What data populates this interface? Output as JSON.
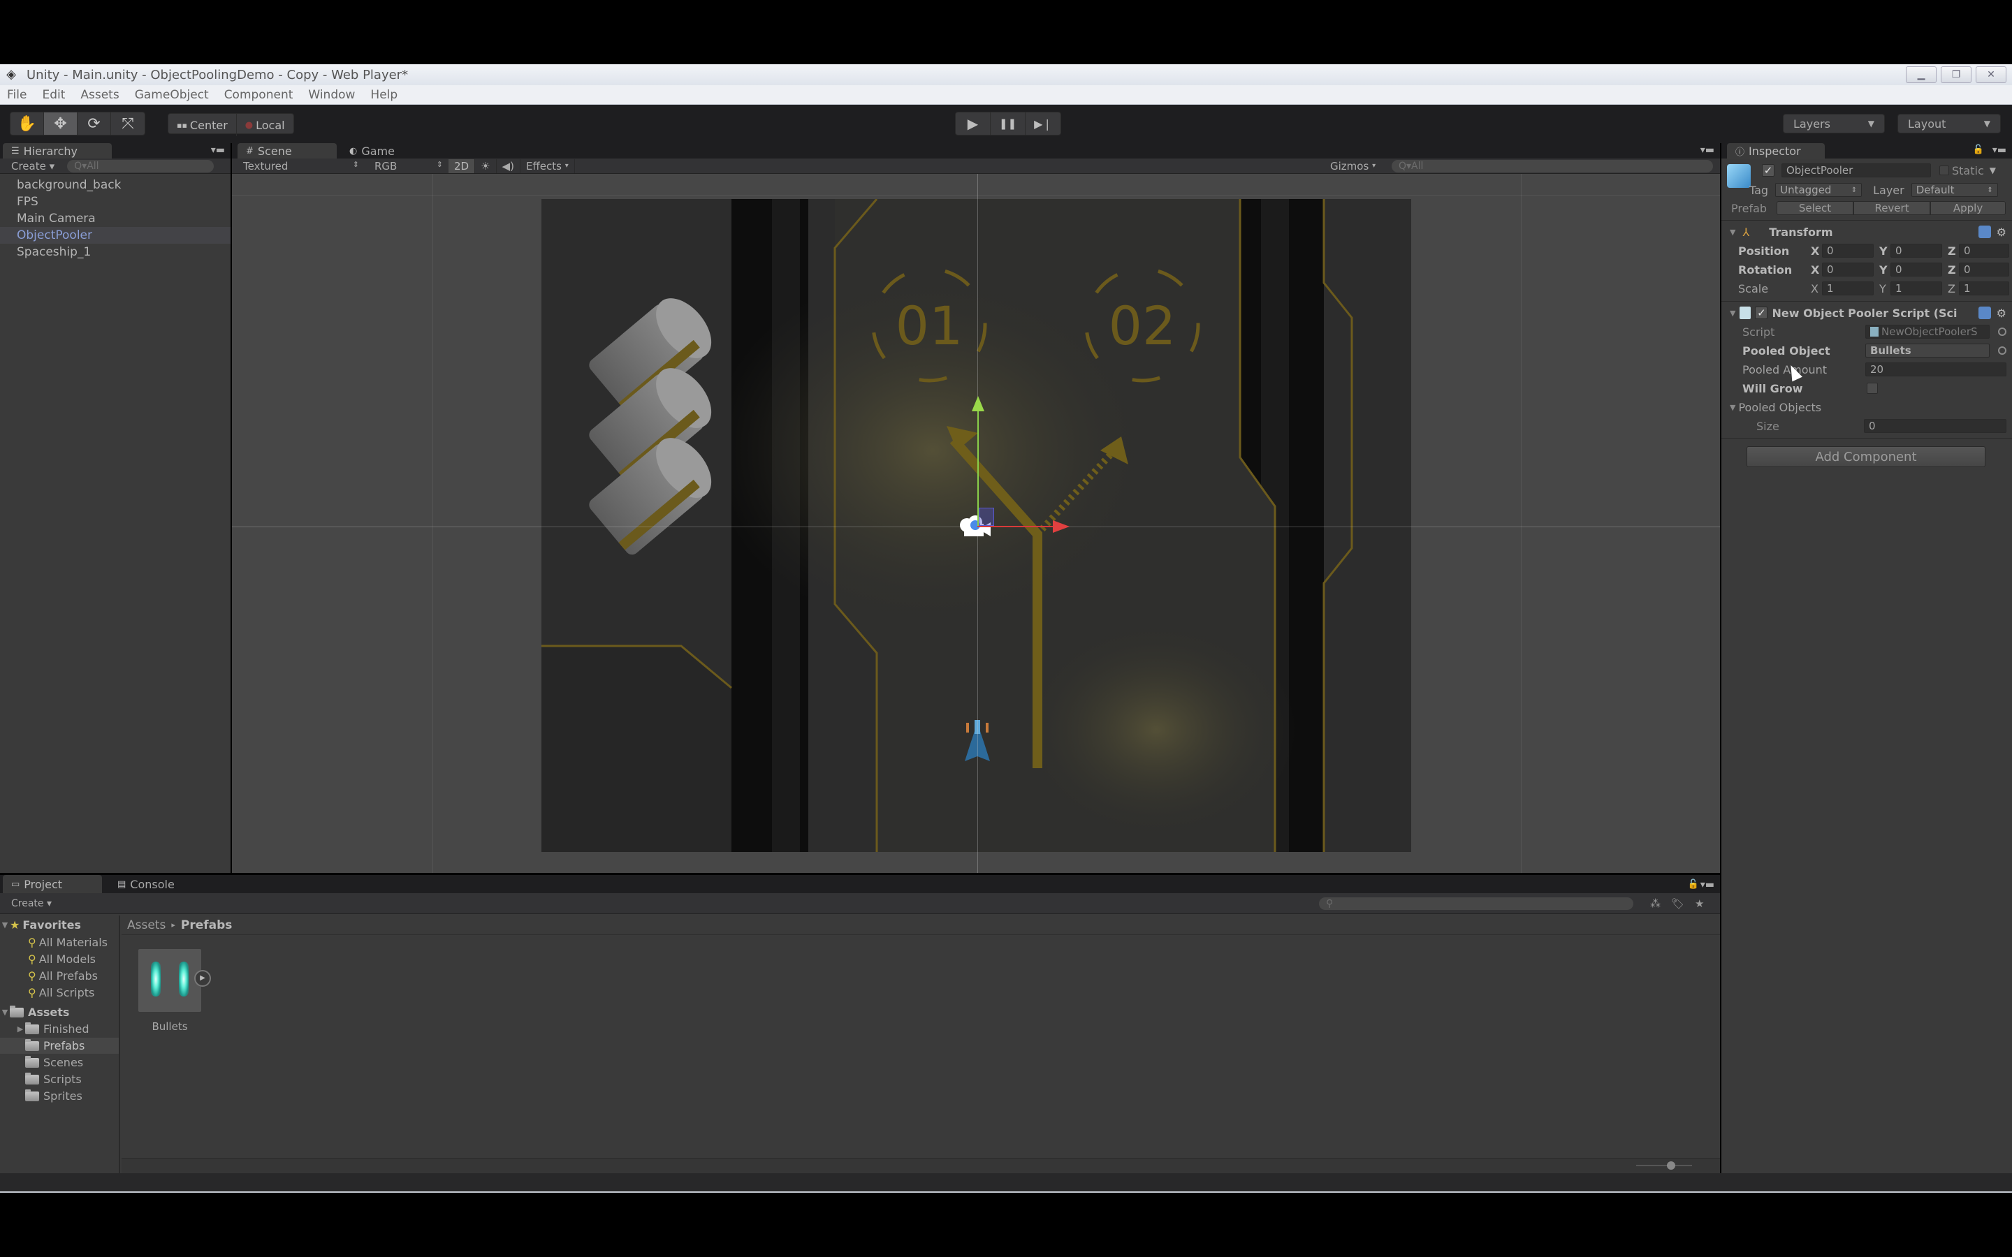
{
  "window": {
    "title": "Unity - Main.unity - ObjectPoolingDemo - Copy - Web Player*",
    "controls": [
      "minimize-icon",
      "restore-icon",
      "close-icon"
    ]
  },
  "menubar": {
    "items": [
      "File",
      "Edit",
      "Assets",
      "GameObject",
      "Component",
      "Window",
      "Help"
    ]
  },
  "toolbar": {
    "transform_tools": [
      {
        "name": "hand",
        "icon": "✋"
      },
      {
        "name": "move",
        "icon": "✥"
      },
      {
        "name": "rotate",
        "icon": "⟳"
      },
      {
        "name": "scale",
        "icon": "⤧"
      }
    ],
    "active_tool": "move",
    "pivot_mode": "Center",
    "pivot_rotation": "Local",
    "play_controls": {
      "play": "▶",
      "pause": "❚❚",
      "step": "▶❘"
    },
    "layers_label": "Layers",
    "layout_label": "Layout"
  },
  "hierarchy": {
    "tab_label": "Hierarchy",
    "create_label": "Create",
    "search_placeholder": "Q▾All",
    "items": [
      "background_back",
      "FPS",
      "Main Camera",
      "ObjectPooler",
      "Spaceship_1"
    ],
    "selected": "ObjectPooler"
  },
  "scene": {
    "tabs": [
      {
        "label": "Scene",
        "icon": "#"
      },
      {
        "label": "Game",
        "icon": "◐"
      }
    ],
    "active_tab": "Scene",
    "render_mode": "Textured",
    "color_mode": "RGB",
    "toggle_2d": "2D",
    "lighting_icon": "☀",
    "audio_icon": "◀)",
    "effects_label": "Effects",
    "gizmos_label": "Gizmos",
    "search_placeholder": "Q▾All",
    "pad_labels": [
      "01",
      "02"
    ]
  },
  "inspector": {
    "tab_label": "Inspector",
    "object": {
      "active": true,
      "name": "ObjectPooler",
      "static_label": "Static",
      "static": false,
      "tag_label": "Tag",
      "tag": "Untagged",
      "layer_label": "Layer",
      "layer": "Default",
      "prefab_label": "Prefab",
      "prefab_buttons": [
        "Select",
        "Revert",
        "Apply"
      ]
    },
    "transform": {
      "title": "Transform",
      "rows": [
        {
          "label": "Position",
          "x": "0",
          "y": "0",
          "z": "0"
        },
        {
          "label": "Rotation",
          "x": "0",
          "y": "0",
          "z": "0"
        },
        {
          "label": "Scale",
          "x": "1",
          "y": "1",
          "z": "1"
        }
      ]
    },
    "script_component": {
      "title": "New Object Pooler Script (Sci",
      "enabled": true,
      "script_label": "Script",
      "script_value": "NewObjectPoolerS",
      "pooled_object_label": "Pooled Object",
      "pooled_object_value": "Bullets",
      "pooled_amount_label": "Pooled Amount",
      "pooled_amount_value": "20",
      "will_grow_label": "Will Grow",
      "will_grow": false,
      "pooled_objects_label": "Pooled Objects",
      "size_label": "Size",
      "size_value": "0"
    },
    "add_component_label": "Add Component"
  },
  "project": {
    "tabs": [
      {
        "label": "Project",
        "icon": "▭"
      },
      {
        "label": "Console",
        "icon": "▤"
      }
    ],
    "active_tab": "Project",
    "create_label": "Create",
    "favorites_label": "Favorites",
    "favorites": [
      "All Materials",
      "All Models",
      "All Prefabs",
      "All Scripts"
    ],
    "assets_label": "Assets",
    "folders": [
      "Finished",
      "Prefabs",
      "Scenes",
      "Scripts",
      "Sprites"
    ],
    "selected_folder": "Prefabs",
    "breadcrumb": [
      "Assets",
      "Prefabs"
    ],
    "assets": [
      {
        "name": "Bullets"
      }
    ]
  }
}
